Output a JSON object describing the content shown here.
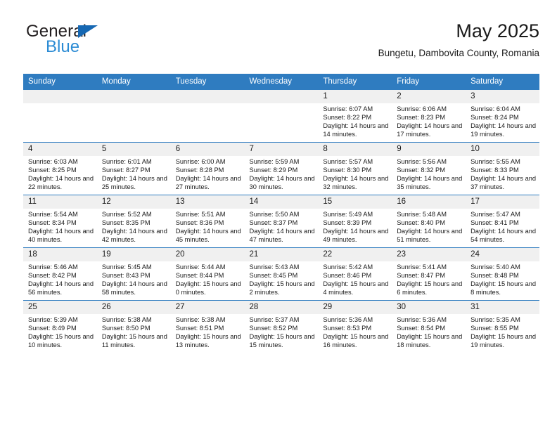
{
  "brand": {
    "word_one": "General",
    "word_two": "Blue",
    "triangle_color": "#1668b3",
    "word_two_color": "#2b8bd4"
  },
  "header": {
    "title": "May 2025",
    "location": "Bungetu, Dambovita County, Romania"
  },
  "theme": {
    "header_bg": "#2f7cc0",
    "header_text": "#ffffff",
    "daynum_bg": "#f0f0f0",
    "cell_bg": "#ffffff",
    "text": "#1a1a1a"
  },
  "weekday_headers": [
    "Sunday",
    "Monday",
    "Tuesday",
    "Wednesday",
    "Thursday",
    "Friday",
    "Saturday"
  ],
  "weeks": [
    [
      {
        "day": "",
        "empty": true
      },
      {
        "day": "",
        "empty": true
      },
      {
        "day": "",
        "empty": true
      },
      {
        "day": "",
        "empty": true
      },
      {
        "day": "1",
        "sunrise": "Sunrise: 6:07 AM",
        "sunset": "Sunset: 8:22 PM",
        "daylight": "Daylight: 14 hours and 14 minutes."
      },
      {
        "day": "2",
        "sunrise": "Sunrise: 6:06 AM",
        "sunset": "Sunset: 8:23 PM",
        "daylight": "Daylight: 14 hours and 17 minutes."
      },
      {
        "day": "3",
        "sunrise": "Sunrise: 6:04 AM",
        "sunset": "Sunset: 8:24 PM",
        "daylight": "Daylight: 14 hours and 19 minutes."
      }
    ],
    [
      {
        "day": "4",
        "sunrise": "Sunrise: 6:03 AM",
        "sunset": "Sunset: 8:25 PM",
        "daylight": "Daylight: 14 hours and 22 minutes."
      },
      {
        "day": "5",
        "sunrise": "Sunrise: 6:01 AM",
        "sunset": "Sunset: 8:27 PM",
        "daylight": "Daylight: 14 hours and 25 minutes."
      },
      {
        "day": "6",
        "sunrise": "Sunrise: 6:00 AM",
        "sunset": "Sunset: 8:28 PM",
        "daylight": "Daylight: 14 hours and 27 minutes."
      },
      {
        "day": "7",
        "sunrise": "Sunrise: 5:59 AM",
        "sunset": "Sunset: 8:29 PM",
        "daylight": "Daylight: 14 hours and 30 minutes."
      },
      {
        "day": "8",
        "sunrise": "Sunrise: 5:57 AM",
        "sunset": "Sunset: 8:30 PM",
        "daylight": "Daylight: 14 hours and 32 minutes."
      },
      {
        "day": "9",
        "sunrise": "Sunrise: 5:56 AM",
        "sunset": "Sunset: 8:32 PM",
        "daylight": "Daylight: 14 hours and 35 minutes."
      },
      {
        "day": "10",
        "sunrise": "Sunrise: 5:55 AM",
        "sunset": "Sunset: 8:33 PM",
        "daylight": "Daylight: 14 hours and 37 minutes."
      }
    ],
    [
      {
        "day": "11",
        "sunrise": "Sunrise: 5:54 AM",
        "sunset": "Sunset: 8:34 PM",
        "daylight": "Daylight: 14 hours and 40 minutes."
      },
      {
        "day": "12",
        "sunrise": "Sunrise: 5:52 AM",
        "sunset": "Sunset: 8:35 PM",
        "daylight": "Daylight: 14 hours and 42 minutes."
      },
      {
        "day": "13",
        "sunrise": "Sunrise: 5:51 AM",
        "sunset": "Sunset: 8:36 PM",
        "daylight": "Daylight: 14 hours and 45 minutes."
      },
      {
        "day": "14",
        "sunrise": "Sunrise: 5:50 AM",
        "sunset": "Sunset: 8:37 PM",
        "daylight": "Daylight: 14 hours and 47 minutes."
      },
      {
        "day": "15",
        "sunrise": "Sunrise: 5:49 AM",
        "sunset": "Sunset: 8:39 PM",
        "daylight": "Daylight: 14 hours and 49 minutes."
      },
      {
        "day": "16",
        "sunrise": "Sunrise: 5:48 AM",
        "sunset": "Sunset: 8:40 PM",
        "daylight": "Daylight: 14 hours and 51 minutes."
      },
      {
        "day": "17",
        "sunrise": "Sunrise: 5:47 AM",
        "sunset": "Sunset: 8:41 PM",
        "daylight": "Daylight: 14 hours and 54 minutes."
      }
    ],
    [
      {
        "day": "18",
        "sunrise": "Sunrise: 5:46 AM",
        "sunset": "Sunset: 8:42 PM",
        "daylight": "Daylight: 14 hours and 56 minutes."
      },
      {
        "day": "19",
        "sunrise": "Sunrise: 5:45 AM",
        "sunset": "Sunset: 8:43 PM",
        "daylight": "Daylight: 14 hours and 58 minutes."
      },
      {
        "day": "20",
        "sunrise": "Sunrise: 5:44 AM",
        "sunset": "Sunset: 8:44 PM",
        "daylight": "Daylight: 15 hours and 0 minutes."
      },
      {
        "day": "21",
        "sunrise": "Sunrise: 5:43 AM",
        "sunset": "Sunset: 8:45 PM",
        "daylight": "Daylight: 15 hours and 2 minutes."
      },
      {
        "day": "22",
        "sunrise": "Sunrise: 5:42 AM",
        "sunset": "Sunset: 8:46 PM",
        "daylight": "Daylight: 15 hours and 4 minutes."
      },
      {
        "day": "23",
        "sunrise": "Sunrise: 5:41 AM",
        "sunset": "Sunset: 8:47 PM",
        "daylight": "Daylight: 15 hours and 6 minutes."
      },
      {
        "day": "24",
        "sunrise": "Sunrise: 5:40 AM",
        "sunset": "Sunset: 8:48 PM",
        "daylight": "Daylight: 15 hours and 8 minutes."
      }
    ],
    [
      {
        "day": "25",
        "sunrise": "Sunrise: 5:39 AM",
        "sunset": "Sunset: 8:49 PM",
        "daylight": "Daylight: 15 hours and 10 minutes."
      },
      {
        "day": "26",
        "sunrise": "Sunrise: 5:38 AM",
        "sunset": "Sunset: 8:50 PM",
        "daylight": "Daylight: 15 hours and 11 minutes."
      },
      {
        "day": "27",
        "sunrise": "Sunrise: 5:38 AM",
        "sunset": "Sunset: 8:51 PM",
        "daylight": "Daylight: 15 hours and 13 minutes."
      },
      {
        "day": "28",
        "sunrise": "Sunrise: 5:37 AM",
        "sunset": "Sunset: 8:52 PM",
        "daylight": "Daylight: 15 hours and 15 minutes."
      },
      {
        "day": "29",
        "sunrise": "Sunrise: 5:36 AM",
        "sunset": "Sunset: 8:53 PM",
        "daylight": "Daylight: 15 hours and 16 minutes."
      },
      {
        "day": "30",
        "sunrise": "Sunrise: 5:36 AM",
        "sunset": "Sunset: 8:54 PM",
        "daylight": "Daylight: 15 hours and 18 minutes."
      },
      {
        "day": "31",
        "sunrise": "Sunrise: 5:35 AM",
        "sunset": "Sunset: 8:55 PM",
        "daylight": "Daylight: 15 hours and 19 minutes."
      }
    ]
  ]
}
